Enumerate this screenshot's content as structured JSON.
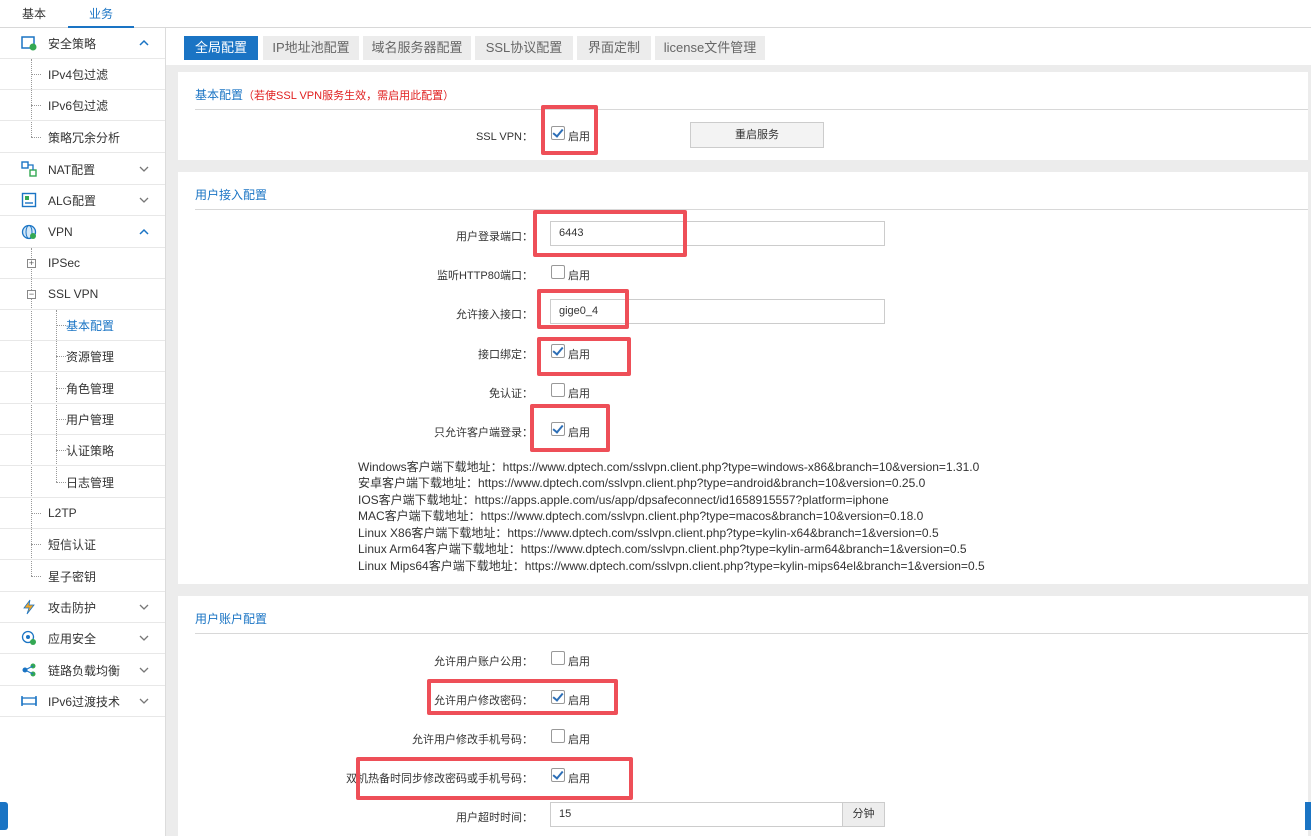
{
  "top_tabs": [
    "基本",
    "业务"
  ],
  "sidebar": {
    "groups": [
      {
        "label": "安全策略",
        "icon": "shield-policy-icon",
        "expanded": true
      },
      {
        "label": "NAT配置",
        "icon": "nat-icon",
        "expanded": false
      },
      {
        "label": "ALG配置",
        "icon": "alg-icon",
        "expanded": false
      },
      {
        "label": "VPN",
        "icon": "vpn-globe-icon",
        "expanded": true
      },
      {
        "label": "攻击防护",
        "icon": "attack-protect-icon",
        "expanded": false
      },
      {
        "label": "应用安全",
        "icon": "app-security-icon",
        "expanded": false
      },
      {
        "label": "链路负载均衡",
        "icon": "link-balance-icon",
        "expanded": false
      },
      {
        "label": "IPv6过渡技术",
        "icon": "ipv6-icon",
        "expanded": false
      }
    ],
    "policy_items": [
      "IPv4包过滤",
      "IPv6包过滤",
      "策略冗余分析"
    ],
    "vpn_items": [
      "IPSec",
      "SSL VPN",
      "L2TP",
      "短信认证",
      "星子密钥"
    ],
    "sslvpn_items": [
      "基本配置",
      "资源管理",
      "角色管理",
      "用户管理",
      "认证策略",
      "日志管理"
    ]
  },
  "content_tabs": [
    "全局配置",
    "IP地址池配置",
    "域名服务器配置",
    "SSL协议配置",
    "界面定制",
    "license文件管理"
  ],
  "basic": {
    "title": "基本配置",
    "note": "（若使SSL VPN服务生效，需启用此配置）",
    "ssl_vpn_label": "SSL VPN：",
    "enable": "启用",
    "restart_button": "重启服务"
  },
  "access": {
    "title": "用户接入配置",
    "port_label": "用户登录端口：",
    "port_value": "6443",
    "http80_label": "监听HTTP80端口：",
    "iface_label": "允许接入接口：",
    "iface_value": "gige0_4",
    "bind_label": "接口绑定：",
    "noauth_label": "免认证：",
    "clientonly_label": "只允许客户端登录：",
    "enable": "启用",
    "links": [
      "Windows客户端下载地址：https://www.dptech.com/sslvpn.client.php?type=windows-x86&branch=10&version=1.31.0",
      "安卓客户端下载地址：https://www.dptech.com/sslvpn.client.php?type=android&branch=10&version=0.25.0",
      "IOS客户端下载地址：https://apps.apple.com/us/app/dpsafeconnect/id1658915557?platform=iphone",
      "MAC客户端下载地址：https://www.dptech.com/sslvpn.client.php?type=macos&branch=10&version=0.18.0",
      "Linux X86客户端下载地址：https://www.dptech.com/sslvpn.client.php?type=kylin-x64&branch=1&version=0.5",
      "Linux Arm64客户端下载地址：https://www.dptech.com/sslvpn.client.php?type=kylin-arm64&branch=1&version=0.5",
      "Linux Mips64客户端下载地址：https://www.dptech.com/sslvpn.client.php?type=kylin-mips64el&branch=1&version=0.5"
    ]
  },
  "account": {
    "title": "用户账户配置",
    "share_label": "允许用户账户公用：",
    "chpwd_label": "允许用户修改密码：",
    "chphone_label": "允许用户修改手机号码：",
    "ha_label": "双机热备时同步修改密码或手机号码：",
    "timeout_label": "用户超时时间：",
    "timeout_value": "15",
    "timeout_unit": "分钟",
    "enable": "启用"
  },
  "colors": {
    "accent": "#1a74c4",
    "highlight": "#ee4f58",
    "note": "#e02020"
  }
}
